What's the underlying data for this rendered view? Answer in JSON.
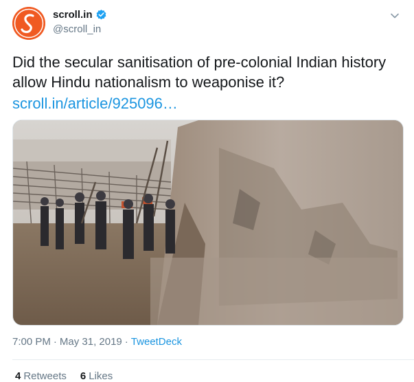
{
  "author": {
    "display_name": "scroll.in",
    "handle": "@scroll_in",
    "verified": true,
    "avatar_letter": "S",
    "avatar_color": "#f05a22"
  },
  "tweet": {
    "text": "Did the secular sanitisation of pre-colonial Indian history allow Hindu nationalism to weaponise it?",
    "link_text": "scroll.in/article/925096…",
    "time": "7:00 PM",
    "date": "May 31, 2019",
    "separator": "·",
    "source": "TweetDeck"
  },
  "stats": {
    "retweets_count": "4",
    "retweets_label": "Retweets",
    "likes_count": "6",
    "likes_label": "Likes"
  },
  "colors": {
    "link": "#1b95e0",
    "muted": "#657786",
    "text": "#14171a"
  },
  "icons": {
    "verified": "verified-badge-icon",
    "caret": "chevron-down-icon"
  }
}
